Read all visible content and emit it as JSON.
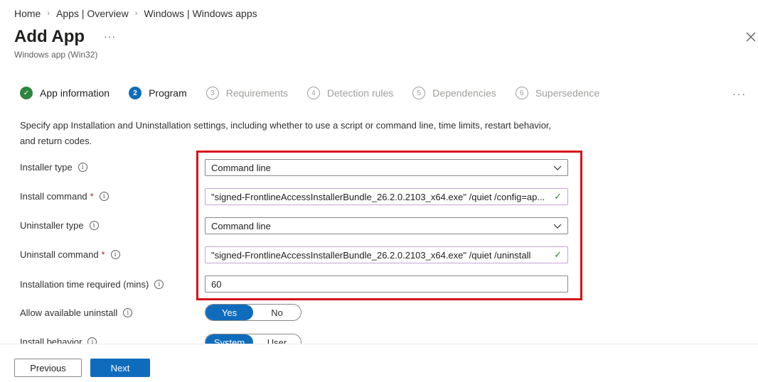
{
  "breadcrumb": [
    "Home",
    "Apps | Overview",
    "Windows | Windows apps"
  ],
  "header": {
    "title": "Add App",
    "more": "···",
    "subtitle": "Windows app (Win32)"
  },
  "steps": [
    {
      "number": "✓",
      "label": "App information",
      "state": "done"
    },
    {
      "number": "2",
      "label": "Program",
      "state": "active"
    },
    {
      "number": "3",
      "label": "Requirements",
      "state": "pending"
    },
    {
      "number": "4",
      "label": "Detection rules",
      "state": "pending"
    },
    {
      "number": "5",
      "label": "Dependencies",
      "state": "pending"
    },
    {
      "number": "6",
      "label": "Supersedence",
      "state": "pending"
    }
  ],
  "steps_more": "···",
  "description": "Specify app Installation and Uninstallation settings, including whether to use a script or command line, time limits, restart behavior, and return codes.",
  "form": {
    "installer_type": {
      "label": "Installer type",
      "value": "Command line"
    },
    "install_command": {
      "label": "Install command",
      "required": "*",
      "value": "\"signed-FrontlineAccessInstallerBundle_26.2.0.2103_x64.exe\" /quiet /config=ap..."
    },
    "uninstaller_type": {
      "label": "Uninstaller type",
      "value": "Command line"
    },
    "uninstall_command": {
      "label": "Uninstall command",
      "required": "*",
      "value": "\"signed-FrontlineAccessInstallerBundle_26.2.0.2103_x64.exe\" /quiet /uninstall"
    },
    "install_time": {
      "label": "Installation time required (mins)",
      "value": "60"
    },
    "allow_uninstall": {
      "label": "Allow available uninstall",
      "options": [
        "Yes",
        "No"
      ],
      "selected": "Yes"
    },
    "install_behavior": {
      "label": "Install behavior",
      "options": [
        "System",
        "User"
      ],
      "selected": "System"
    }
  },
  "footer": {
    "previous": "Previous",
    "next": "Next"
  },
  "colors": {
    "accent": "#0f6cbd",
    "success": "#2e8540",
    "highlight": "#d6101a",
    "required": "#a4262c"
  }
}
